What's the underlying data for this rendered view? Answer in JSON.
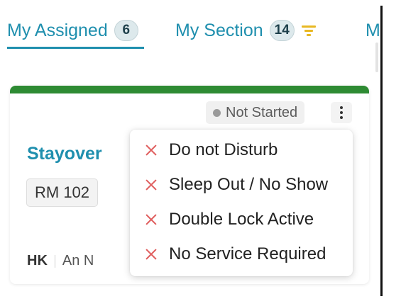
{
  "tabs": [
    {
      "label": "My Assigned",
      "count": "6",
      "active": true
    },
    {
      "label": "My Section",
      "count": "14",
      "active": false
    },
    {
      "label": "M",
      "active": false
    }
  ],
  "card": {
    "status_color": "#2e8b33",
    "status": "Not Started",
    "room_type": "Stayover",
    "room": "RM 102",
    "department": "HK",
    "assignee": "An N"
  },
  "menu": {
    "items": [
      {
        "label": "Do not Disturb",
        "icon": "close-icon"
      },
      {
        "label": "Sleep Out / No Show",
        "icon": "close-icon"
      },
      {
        "label": "Double Lock Active",
        "icon": "close-icon"
      },
      {
        "label": "No Service Required",
        "icon": "close-icon"
      }
    ]
  },
  "colors": {
    "accent": "#1f8fae",
    "filter_icon": "#e8b823",
    "menu_icon": "#e06060"
  }
}
